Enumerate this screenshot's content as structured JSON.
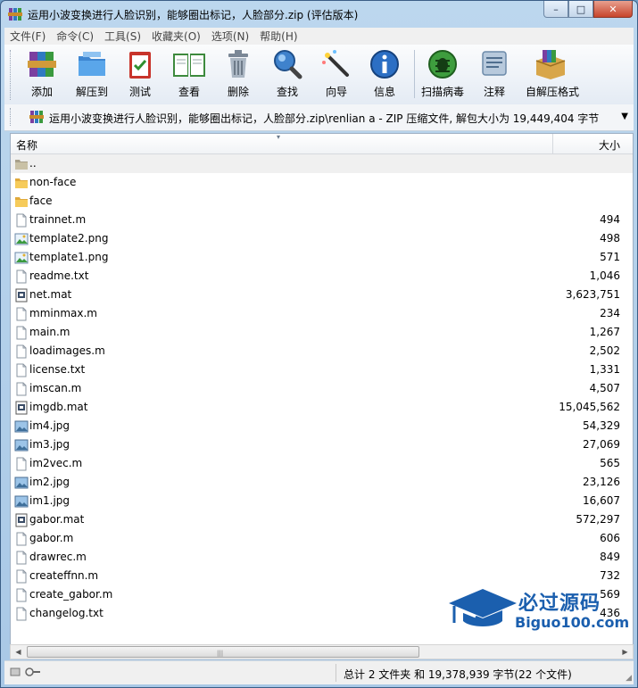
{
  "window": {
    "title": "运用小波变换进行人脸识别，能够圈出标记，人脸部分.zip (评估版本)",
    "controls": {
      "minimize": "–",
      "maximize": "□",
      "close": "✕"
    }
  },
  "menu": [
    "文件(F)",
    "命令(C)",
    "工具(S)",
    "收藏夹(O)",
    "选项(N)",
    "帮助(H)"
  ],
  "toolbar": [
    {
      "id": "add",
      "label": "添加",
      "icon": "add-archive-icon"
    },
    {
      "id": "extract",
      "label": "解压到",
      "icon": "extract-folder-icon"
    },
    {
      "id": "test",
      "label": "测试",
      "icon": "test-clipboard-icon"
    },
    {
      "id": "view",
      "label": "查看",
      "icon": "book-icon"
    },
    {
      "id": "delete",
      "label": "删除",
      "icon": "trash-icon"
    },
    {
      "id": "find",
      "label": "查找",
      "icon": "magnifier-icon"
    },
    {
      "id": "wizard",
      "label": "向导",
      "icon": "magic-wand-icon"
    },
    {
      "id": "info",
      "label": "信息",
      "icon": "info-icon"
    },
    {
      "id": "scan",
      "label": "扫描病毒",
      "icon": "virus-scan-icon"
    },
    {
      "id": "comment",
      "label": "注释",
      "icon": "comment-icon"
    },
    {
      "id": "sfx",
      "label": "自解压格式",
      "icon": "sfx-box-icon"
    }
  ],
  "address": {
    "path": "运用小波变换进行人脸识别，能够圈出标记，人脸部分.zip\\renlian a - ZIP 压缩文件, 解包大小为 19,449,404 字节"
  },
  "columns": {
    "name": "名称",
    "size": "大小"
  },
  "files": [
    {
      "name": "..",
      "size": "",
      "type": "parent"
    },
    {
      "name": "non-face",
      "size": "",
      "type": "folder"
    },
    {
      "name": "face",
      "size": "",
      "type": "folder"
    },
    {
      "name": "trainnet.m",
      "size": "494",
      "type": "file"
    },
    {
      "name": "template2.png",
      "size": "498",
      "type": "image"
    },
    {
      "name": "template1.png",
      "size": "571",
      "type": "image"
    },
    {
      "name": "readme.txt",
      "size": "1,046",
      "type": "file"
    },
    {
      "name": "net.mat",
      "size": "3,623,751",
      "type": "mat"
    },
    {
      "name": "mminmax.m",
      "size": "234",
      "type": "file"
    },
    {
      "name": "main.m",
      "size": "1,267",
      "type": "file"
    },
    {
      "name": "loadimages.m",
      "size": "2,502",
      "type": "file"
    },
    {
      "name": "license.txt",
      "size": "1,331",
      "type": "file"
    },
    {
      "name": "imscan.m",
      "size": "4,507",
      "type": "file"
    },
    {
      "name": "imgdb.mat",
      "size": "15,045,562",
      "type": "mat"
    },
    {
      "name": "im4.jpg",
      "size": "54,329",
      "type": "photo"
    },
    {
      "name": "im3.jpg",
      "size": "27,069",
      "type": "photo"
    },
    {
      "name": "im2vec.m",
      "size": "565",
      "type": "file"
    },
    {
      "name": "im2.jpg",
      "size": "23,126",
      "type": "photo"
    },
    {
      "name": "im1.jpg",
      "size": "16,607",
      "type": "photo"
    },
    {
      "name": "gabor.mat",
      "size": "572,297",
      "type": "mat"
    },
    {
      "name": "gabor.m",
      "size": "606",
      "type": "file"
    },
    {
      "name": "drawrec.m",
      "size": "849",
      "type": "file"
    },
    {
      "name": "createffnn.m",
      "size": "732",
      "type": "file"
    },
    {
      "name": "create_gabor.m",
      "size": "569",
      "type": "file"
    },
    {
      "name": "changelog.txt",
      "size": "436",
      "type": "file"
    }
  ],
  "status": {
    "summary": "总计 2 文件夹 和 19,378,939 字节(22 个文件)"
  },
  "watermark": {
    "brand": "必过源码",
    "url": "Biguo100.com"
  }
}
